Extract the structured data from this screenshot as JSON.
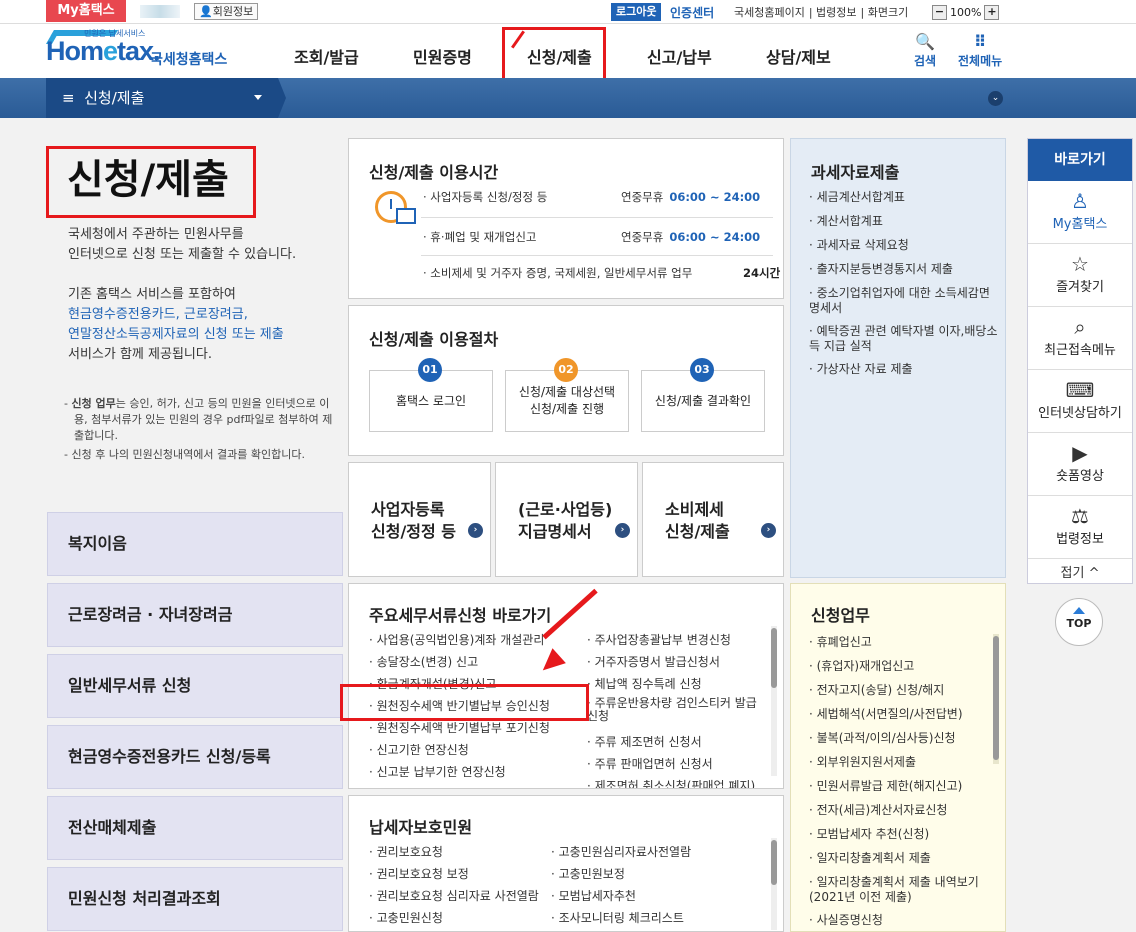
{
  "topbar": {
    "myhometax": "My홈택스",
    "member_info": "회원정보",
    "logout": "로그아웃",
    "certificate": "인증센터",
    "links": [
      "국세청홈페이지",
      "법령정보",
      "화면크기"
    ],
    "zoom": "100%",
    "zoom_minus": "−",
    "zoom_plus": "+"
  },
  "header": {
    "logo_small": "민원은 납세서비스",
    "logo_main_a": "Hom",
    "logo_main_e": "e",
    "logo_main_b": "tax.",
    "logo_sub": "국세청홈택스",
    "nav": [
      "조회/발급",
      "민원증명",
      "신청/제출",
      "신고/납부",
      "상담/제보"
    ],
    "search": "검색",
    "all_menu": "전체메뉴"
  },
  "breadcrumb": {
    "label": "신청/제출",
    "menu_glyph": "≡"
  },
  "left": {
    "title": "신청/제출",
    "intro_line1": "국세청에서 주관하는 민원사무를",
    "intro_line2": "인터넷으로 신청 또는 제출할 수 있습니다.",
    "intro_line3": "기존 홈택스 서비스를 포함하여",
    "intro_blue1": "현금영수증전용카드, 근로장려금,",
    "intro_blue2": "연말정산소득공제자료의 신청 또는 제출",
    "intro_line4": "서비스가 함께 제공됩니다.",
    "note1_bold": "신청 업무",
    "note1_rest": "는 승인, 허가, 신고 등의 민원을 인터넷으로 이용, 첨부서류가 있는 민원의 경우 pdf파일로 첨부하여 제출합니다.",
    "note2": "신청 후 나의 민원신청내역에서 결과를 확인합니다.",
    "menu": [
      "복지이음",
      "근로장려금 · 자녀장려금",
      "일반세무서류 신청",
      "현금영수증전용카드 신청/등록",
      "전산매체제출",
      "민원신청 처리결과조회"
    ]
  },
  "hours": {
    "title": "신청/제출 이용시간",
    "rows": [
      {
        "label": "· 사업자등록 신청/정정 등",
        "days": "연중무휴",
        "time": "06:00 ~ 24:00"
      },
      {
        "label": "· 휴·폐업 및 재개업신고",
        "days": "연중무휴",
        "time": "06:00 ~ 24:00"
      },
      {
        "label": "· 소비제세 및 거주자 증명, 국제세원, 일반세무서류 업무",
        "days": "",
        "time": "24시간"
      }
    ]
  },
  "procedure": {
    "title": "신청/제출 이용절차",
    "steps": [
      {
        "num": "01",
        "label": "홈택스 로그인",
        "color": "#1f63b6"
      },
      {
        "num": "02",
        "label": "신청/제출 대상선택 신청/제출 진행",
        "color": "#f0962a"
      },
      {
        "num": "03",
        "label": "신청/제출 결과확인",
        "color": "#1f63b6"
      }
    ]
  },
  "tiles": [
    {
      "line1": "사업자등록",
      "line2": "신청/정정 등"
    },
    {
      "line1": "(근로·사업등)",
      "line2": "지급명세서"
    },
    {
      "line1": "소비제세",
      "line2": "신청/제출"
    }
  ],
  "shortcuts": {
    "title": "주요세무서류신청 바로가기",
    "col1": [
      "· 사업용(공익법인용)계좌 개설관리",
      "· 송달장소(변경) 신고",
      "· 환급계좌개설(변경)신고",
      "· 원천징수세액 반기별납부 승인신청",
      "· 원천징수세액 반기별납부 포기신청",
      "· 신고기한 연장신청",
      "· 신고분 납부기한 연장신청"
    ],
    "col2": [
      "· 주사업장총괄납부 변경신청",
      "· 거주자증명서 발급신청서",
      "· 체납액 징수특례 신청",
      "· 주류운반용차량 검인스티커 발급신청",
      "· 주류 제조면허 신청서",
      "· 주류 판매업면허 신청서",
      "· 제조면허 취소신청(판매업 폐지)"
    ]
  },
  "protection": {
    "title": "납세자보호민원",
    "col1": [
      "· 권리보호요청",
      "· 권리보호요청 보정",
      "· 권리보호요청 심리자료 사전열람",
      "· 고충민원신청"
    ],
    "col2": [
      "· 고충민원심리자료사전열람",
      "· 고충민원보정",
      "· 모범납세자추천",
      "· 조사모니터링 체크리스트"
    ]
  },
  "tax_data": {
    "title": "과세자료제출",
    "items": [
      "· 세금계산서합계표",
      "· 계산서합계표",
      "· 과세자료 삭제요청",
      "· 출자지분등변경통지서 제출",
      "· 중소기업취업자에 대한 소득세감면명세서",
      "· 예탁증권 관련 예탁자별 이자,배당소득 지급 실적",
      "· 가상자산 자료 제출"
    ]
  },
  "apply_work": {
    "title": "신청업무",
    "items": [
      "· 휴폐업신고",
      "· (휴업자)재개업신고",
      "· 전자고지(송달) 신청/해지",
      "· 세법해석(서면질의/사전답변)",
      "· 불복(과적/이의/심사등)신청",
      "· 외부위원지원서제출",
      "· 민원서류발급 제한(해지신고)",
      "· 전자(세금)계산서자료신청",
      "· 모범납세자 추천(신청)",
      "· 일자리창출계획서 제출",
      "· 일자리창출계획서 제출 내역보기(2021년 이전 제출)",
      "· 사실증명신청"
    ]
  },
  "quick": {
    "title": "바로가기",
    "items": [
      {
        "label": "My홈택스",
        "icon": "person-icon"
      },
      {
        "label": "즐겨찾기",
        "icon": "star-icon"
      },
      {
        "label": "최근접속메뉴",
        "icon": "recent-menu-icon"
      },
      {
        "label": "인터넷상담하기",
        "icon": "laptop-chat-icon"
      },
      {
        "label": "숏폼영상",
        "icon": "play-icon"
      },
      {
        "label": "법령정보",
        "icon": "gavel-icon"
      }
    ],
    "fold": "접기 ^",
    "top": "TOP"
  },
  "colors": {
    "brand_blue": "#1f63b6",
    "highlight_red": "#e6191c",
    "myhometax_red": "#e8474f"
  }
}
